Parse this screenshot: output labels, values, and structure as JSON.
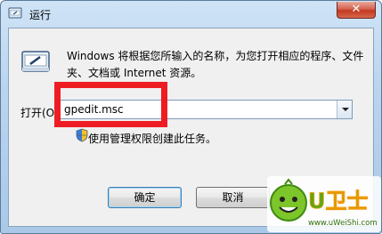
{
  "window": {
    "title": "运行",
    "close_symbol": "✕"
  },
  "dialog": {
    "icon": "run-icon",
    "description": "Windows 将根据您所输入的名称，为您打开相应的程序、文件夹、文档或 Internet 资源。",
    "open_label": "打开(O):",
    "command_value": "gpedit.msc",
    "admin_note": "使用管理权限创建此任务。",
    "ok_label": "确定",
    "cancel_label": "取消"
  },
  "watermark": {
    "brand": "U卫士",
    "url": "www.uWeiShi.com"
  },
  "colors": {
    "highlight": "#ee1d24",
    "logo_green": "#6cbf1f",
    "logo_orange": "#f39800"
  }
}
